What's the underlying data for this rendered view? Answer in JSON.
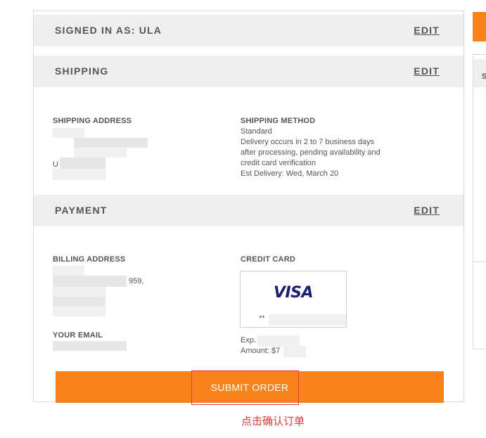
{
  "signed_in": {
    "title": "SIGNED IN AS: ULA",
    "edit_label": "EDIT"
  },
  "shipping": {
    "title": "SHIPPING",
    "edit_label": "EDIT",
    "address_label": "SHIPPING ADDRESS",
    "address_partial_char": "U",
    "method_label": "SHIPPING METHOD",
    "method_lines": [
      "Standard",
      "Delivery occurs in 2 to 7 business days",
      "after processing, pending availability and",
      "credit card verification",
      "Est Delivery: Wed, March 20"
    ]
  },
  "payment": {
    "title": "PAYMENT",
    "edit_label": "EDIT",
    "billing_label": "BILLING ADDRESS",
    "billing_partial_line": "959,",
    "email_label": "YOUR EMAIL",
    "card_label": "CREDIT CARD",
    "card_brand": "VISA",
    "card_mask": "**",
    "exp_label": "Exp.",
    "amount_label": "Amount: $7"
  },
  "submit": {
    "label": "SUBMIT ORDER"
  },
  "annotation": {
    "text": "点击确认订单"
  },
  "side_panel": {
    "header_letter": "S"
  },
  "colors": {
    "accent": "#f8821c",
    "header_bg": "#eeeeee",
    "annotation_red": "#e03a3a",
    "visa_blue": "#1a1f71"
  }
}
